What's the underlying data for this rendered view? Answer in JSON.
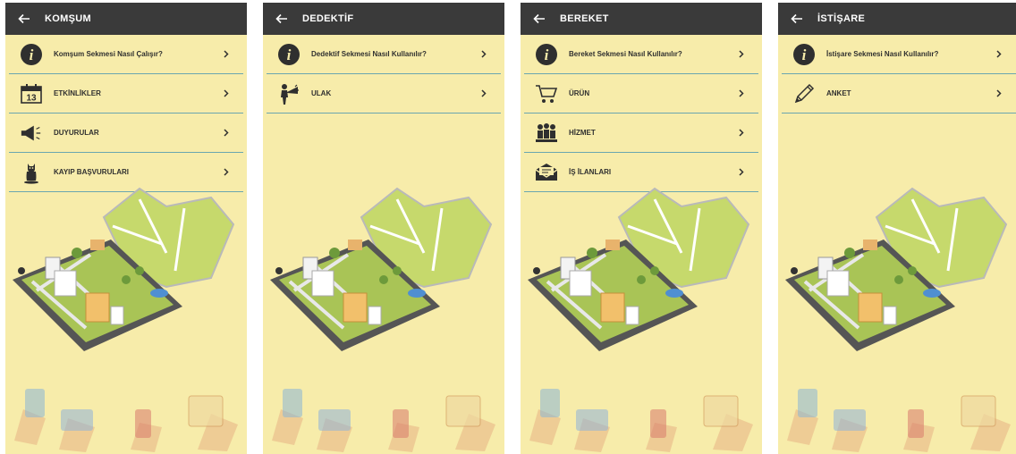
{
  "screens": [
    {
      "title": "KOMŞUM",
      "items": [
        {
          "label": "Komşum Sekmesi Nasıl Çalışır?",
          "icon": "info-icon"
        },
        {
          "label": "ETKİNLİKLER",
          "icon": "calendar-icon",
          "calendar_day": "13"
        },
        {
          "label": "DUYURULAR",
          "icon": "megaphone-icon"
        },
        {
          "label": "KAYIP BAŞVURULARI",
          "icon": "cat-icon"
        }
      ]
    },
    {
      "title": "DEDEKTİF",
      "items": [
        {
          "label": "Dedektif Sekmesi Nasıl Kullanılır?",
          "icon": "info-icon"
        },
        {
          "label": "ULAK",
          "icon": "messenger-icon"
        }
      ]
    },
    {
      "title": "BEREKET",
      "items": [
        {
          "label": "Bereket Sekmesi Nasıl Kullanılır?",
          "icon": "info-icon"
        },
        {
          "label": "ÜRÜN",
          "icon": "cart-icon"
        },
        {
          "label": "HİZMET",
          "icon": "people-icon"
        },
        {
          "label": "İŞ İLANLARI",
          "icon": "envelope-icon"
        }
      ]
    },
    {
      "title": "İSTİŞARE",
      "items": [
        {
          "label": "İstişare Sekmesi Nasıl Kullanılır?",
          "icon": "info-icon"
        },
        {
          "label": "ANKET",
          "icon": "pencil-icon"
        }
      ]
    }
  ],
  "colors": {
    "appbar": "#3a3a3a",
    "background": "#f7ecaa",
    "divider": "#6aa6b0",
    "text": "#2f2f2f"
  }
}
